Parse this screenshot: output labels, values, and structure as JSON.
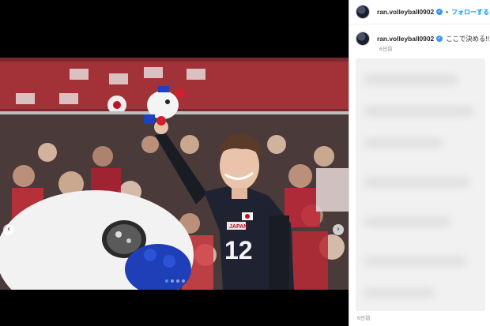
{
  "post": {
    "username": "ran.volleyball0902",
    "verified": true,
    "follow_label": "フォローする",
    "separator": "•"
  },
  "caption": {
    "username": "ran.volleyball0902",
    "text": "ここで決める!!",
    "time": "6日前"
  },
  "footer": {
    "time": "6日前"
  },
  "carousel": {
    "prev_icon": "‹",
    "next_icon": "›",
    "slide_count": 4,
    "active_index": 0
  },
  "photo": {
    "jersey_number": "12",
    "jersey_text": "JAPAN"
  },
  "colors": {
    "link": "#0095f6",
    "verified": "#3897f0"
  }
}
